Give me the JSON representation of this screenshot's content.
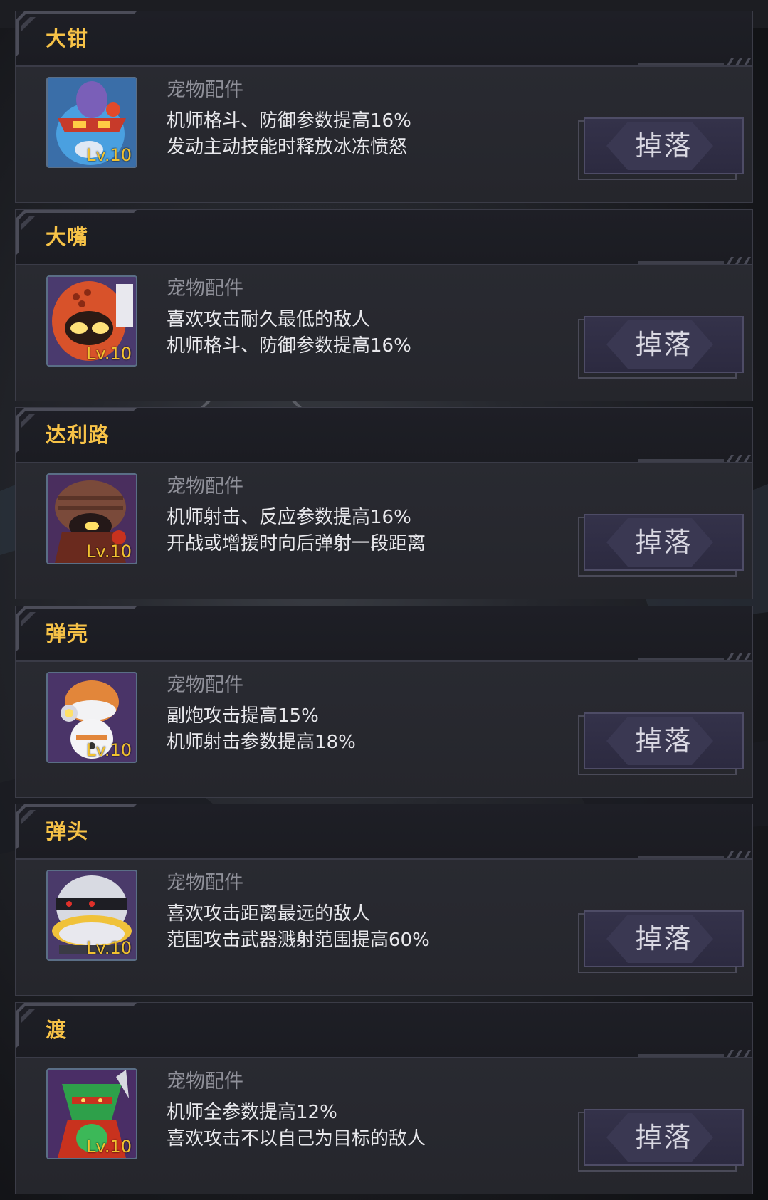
{
  "category_label": "宠物配件",
  "drop_label": "掉落",
  "pets": [
    {
      "name": "大钳",
      "level": "Lv.10",
      "desc_line1": "机师格斗、防御参数提高16%",
      "desc_line2": "发动主动技能时释放冰冻愤怒",
      "icon": "blue-crab-robot-portrait"
    },
    {
      "name": "大嘴",
      "level": "Lv.10",
      "desc_line1": "喜欢攻击耐久最低的敌人",
      "desc_line2": "机师格斗、防御参数提高16%",
      "icon": "red-mouth-robot-portrait"
    },
    {
      "name": "达利路",
      "level": "Lv.10",
      "desc_line1": "机师射击、反应参数提高16%",
      "desc_line2": "开战或增援时向后弹射一段距离",
      "icon": "brown-helmet-robot-portrait"
    },
    {
      "name": "弹壳",
      "level": "Lv.10",
      "desc_line1": "副炮攻击提高15%",
      "desc_line2": "机师射击参数提高18%",
      "icon": "orange-shell-robot-portrait"
    },
    {
      "name": "弹头",
      "level": "Lv.10",
      "desc_line1": "喜欢攻击距离最远的敌人",
      "desc_line2": "范围攻击武器溅射范围提高60%",
      "icon": "silver-warhead-robot-portrait"
    },
    {
      "name": "渡",
      "level": "Lv.10",
      "desc_line1": "机师全参数提高12%",
      "desc_line2": "喜欢攻击不以自己为目标的敌人",
      "icon": "green-ninja-frog-portrait"
    }
  ],
  "colors": {
    "title": "#f6c247",
    "level": "#f2c230",
    "category": "#8f9099",
    "desc": "#e8e8ec",
    "button_text": "#d9d8e2"
  }
}
